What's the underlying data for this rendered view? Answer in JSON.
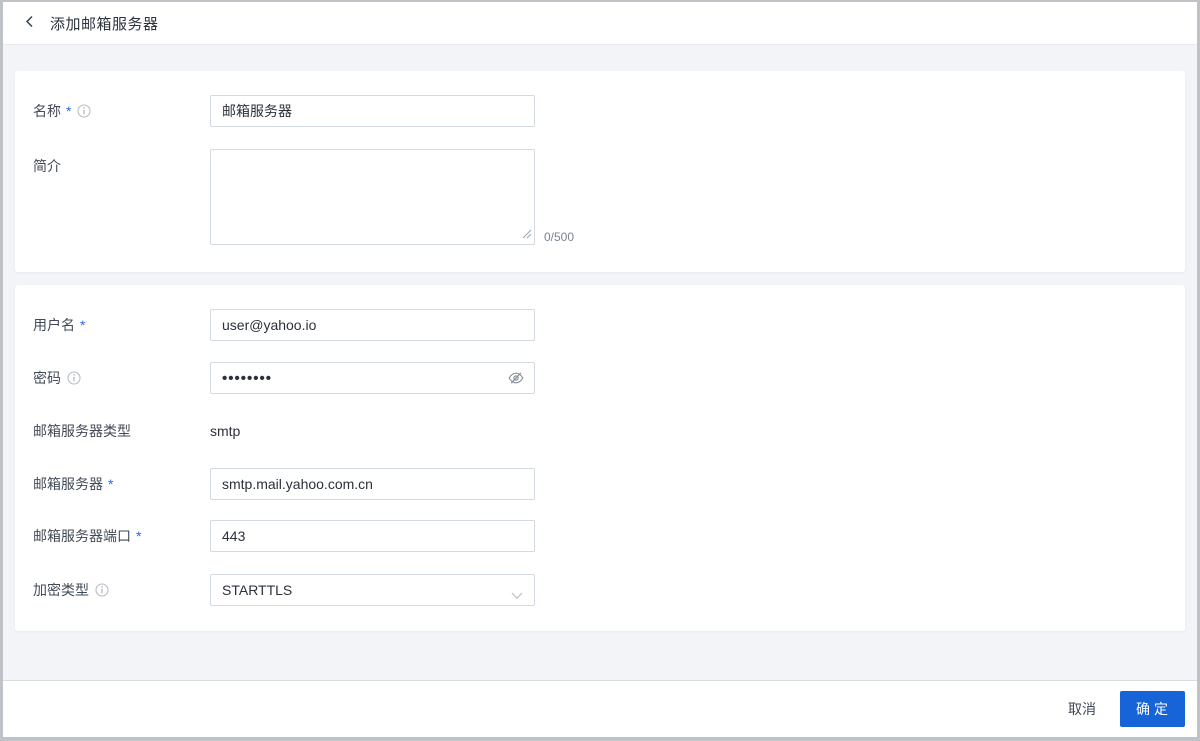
{
  "header": {
    "title": "添加邮箱服务器"
  },
  "common": {
    "required_mark": "*"
  },
  "basic_card": {
    "name": {
      "label": "名称",
      "value": "邮箱服务器",
      "required": true,
      "has_info_icon": true
    },
    "intro": {
      "label": "简介",
      "value": "",
      "counter": "0/500"
    }
  },
  "account_card": {
    "username": {
      "label": "用户名",
      "value": "user@yahoo.io",
      "required": true
    },
    "password": {
      "label": "密码",
      "value": "••••••••",
      "has_info_icon": true,
      "visibility_icon": "eye-off"
    },
    "server_type": {
      "label": "邮箱服务器类型",
      "value": "smtp"
    },
    "server": {
      "label": "邮箱服务器",
      "value": "smtp.mail.yahoo.com.cn",
      "required": true
    },
    "port": {
      "label": "邮箱服务器端口",
      "value": "443",
      "required": true
    },
    "encryption": {
      "label": "加密类型",
      "value": "STARTTLS",
      "has_info_icon": true,
      "control": "dropdown"
    }
  },
  "footer": {
    "cancel": "取消",
    "confirm": "确定"
  },
  "icons": {
    "back": "chevron-left",
    "info": "info-circle",
    "password_toggle": "eye-off",
    "dropdown": "chevron-down",
    "textarea": "resize-handle"
  },
  "colors": {
    "accent": "#1764d9",
    "required_mark": "#2468f2",
    "page_background": "#f2f4f8",
    "card_background": "#ffffff",
    "input_border": "#d4dae1"
  }
}
